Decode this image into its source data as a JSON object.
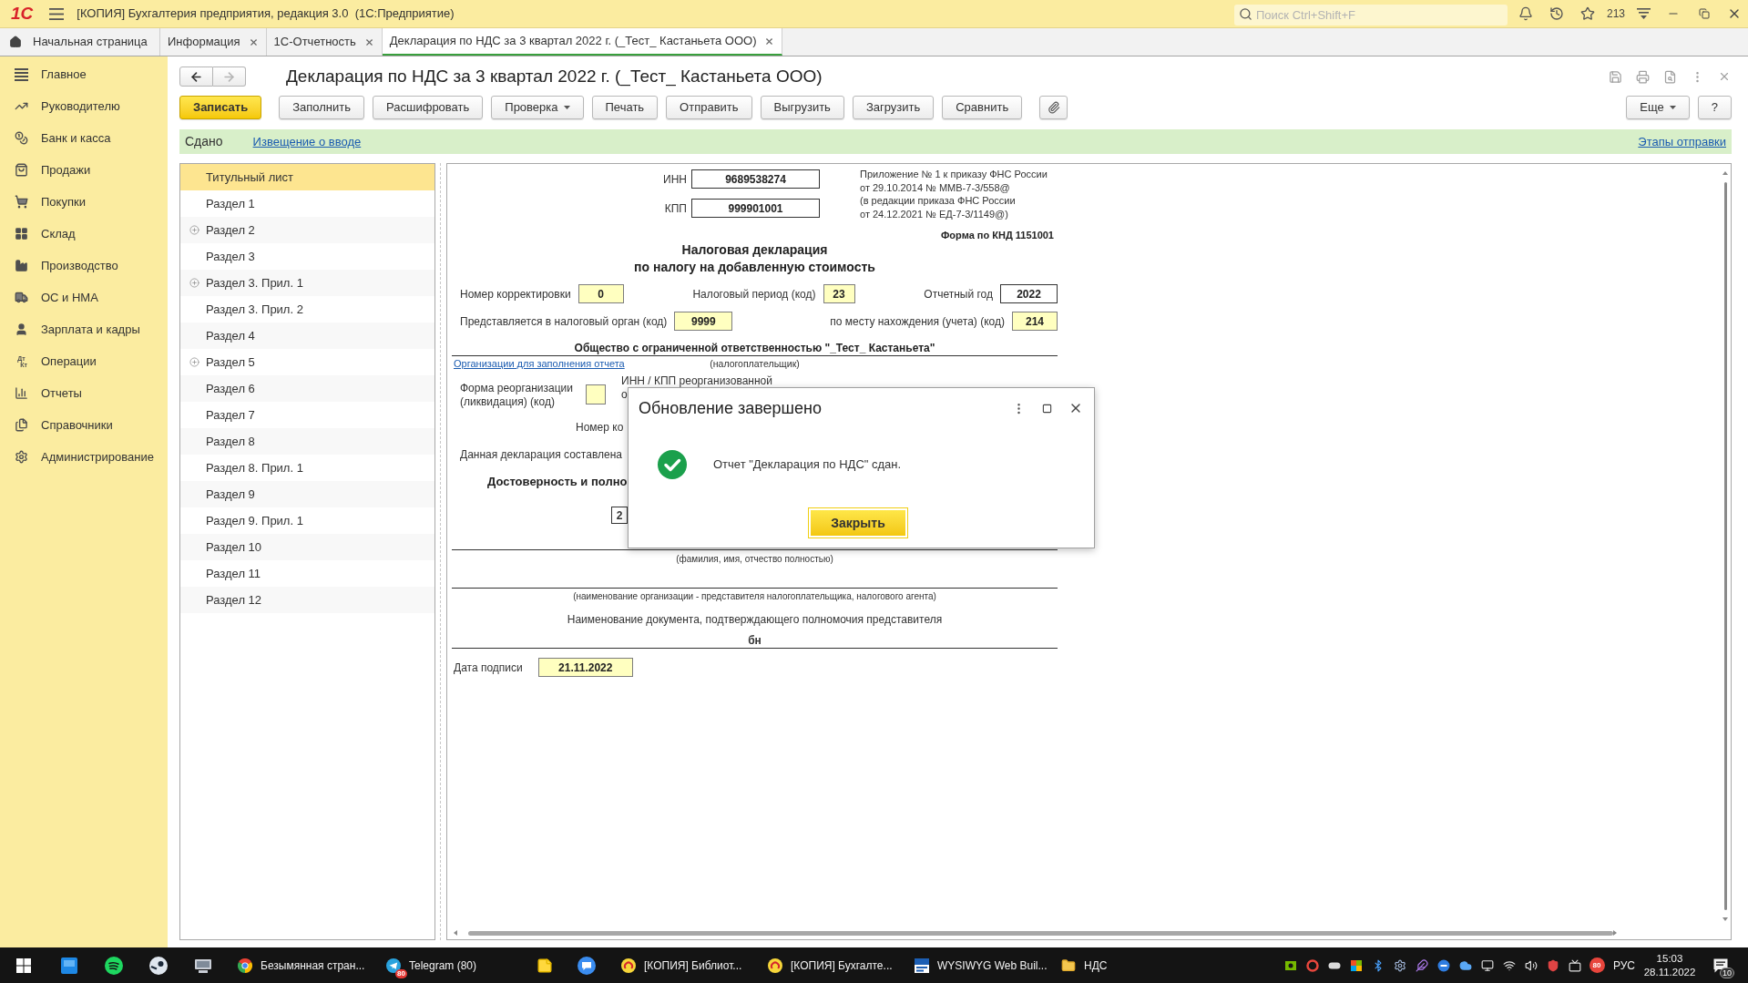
{
  "window": {
    "logo": "1С",
    "title": "[КОПИЯ] Бухгалтерия предприятия, редакция 3.0  (1С:Предприятие)",
    "search": {
      "placeholder": "Поиск Ctrl+Shift+F"
    },
    "counter": "213"
  },
  "tabs": [
    {
      "label": "Начальная страница",
      "kind": "home",
      "selected": false
    },
    {
      "label": "Информация",
      "kind": "page",
      "selected": false
    },
    {
      "label": "1С-Отчетность",
      "kind": "page",
      "selected": false
    },
    {
      "label": "Декларация по НДС за 3 квартал 2022 г. (_Тест_ Кастаньета ООО)",
      "kind": "page",
      "selected": true
    }
  ],
  "sidebar": {
    "items": [
      {
        "label": "Главное"
      },
      {
        "label": "Руководителю"
      },
      {
        "label": "Банк и касса"
      },
      {
        "label": "Продажи"
      },
      {
        "label": "Покупки"
      },
      {
        "label": "Склад"
      },
      {
        "label": "Производство"
      },
      {
        "label": "ОС и НМА"
      },
      {
        "label": "Зарплата и кадры"
      },
      {
        "label": "Операции",
        "icon_text": [
          "Дт",
          "Кт"
        ]
      },
      {
        "label": "Отчеты"
      },
      {
        "label": "Справочники"
      },
      {
        "label": "Администрирование"
      }
    ]
  },
  "document": {
    "navigation": {
      "back": {
        "disabled": false
      },
      "forward": {
        "disabled": true
      }
    },
    "title": "Декларация по НДС за 3 квартал 2022 г. (_Тест_ Кастаньета ООО)",
    "toolbar": [
      {
        "label": "Записать",
        "kind": "primary"
      },
      {
        "label": "Заполнить",
        "kind": "plain"
      },
      {
        "label": "Расшифровать",
        "kind": "plain"
      },
      {
        "label": "Проверка",
        "kind": "menu"
      },
      {
        "label": "Печать",
        "kind": "plain"
      },
      {
        "label": "Отправить",
        "kind": "plain"
      },
      {
        "label": "Выгрузить",
        "kind": "plain"
      },
      {
        "label": "Загрузить",
        "kind": "plain"
      },
      {
        "label": "Сравнить",
        "kind": "plain"
      }
    ],
    "toolbar_right": [
      {
        "label": "Еще",
        "kind": "menu"
      },
      {
        "label": "?",
        "kind": "plain"
      }
    ],
    "status": {
      "state": "Сдано",
      "link": "Извещение о вводе",
      "stages_link": "Этапы отправки"
    }
  },
  "sections": [
    {
      "label": "Титульный лист",
      "selected": true,
      "collapsed": false
    },
    {
      "label": "Раздел 1",
      "selected": false,
      "collapsed": false
    },
    {
      "label": "Раздел 2",
      "selected": false,
      "collapsed": true
    },
    {
      "label": "Раздел 3",
      "selected": false,
      "collapsed": false
    },
    {
      "label": "Раздел 3. Прил. 1",
      "selected": false,
      "collapsed": true
    },
    {
      "label": "Раздел 3. Прил. 2",
      "selected": false,
      "collapsed": false
    },
    {
      "label": "Раздел 4",
      "selected": false,
      "collapsed": false
    },
    {
      "label": "Раздел 5",
      "selected": false,
      "collapsed": true
    },
    {
      "label": "Раздел 6",
      "selected": false,
      "collapsed": false
    },
    {
      "label": "Раздел 7",
      "selected": false,
      "collapsed": false
    },
    {
      "label": "Раздел 8",
      "selected": false,
      "collapsed": false
    },
    {
      "label": "Раздел 8. Прил. 1",
      "selected": false,
      "collapsed": false
    },
    {
      "label": "Раздел 9",
      "selected": false,
      "collapsed": false
    },
    {
      "label": "Раздел 9. Прил. 1",
      "selected": false,
      "collapsed": false
    },
    {
      "label": "Раздел 10",
      "selected": false,
      "collapsed": false
    },
    {
      "label": "Раздел 11",
      "selected": false,
      "collapsed": false
    },
    {
      "label": "Раздел 12",
      "selected": false,
      "collapsed": false
    }
  ],
  "form": {
    "tax_ids": [
      {
        "label": "ИНН",
        "value": "9689538274",
        "editable": false
      },
      {
        "label": "КПП",
        "value": "999901001",
        "editable": false
      }
    ],
    "approval_note": "Приложение № 1 к приказу ФНС России\nот 29.10.2014 № ММВ-7-3/558@\n(в редакции приказа ФНС России\nот 24.12.2021 № ЕД-7-3/1149@)",
    "form_code": "Форма по КНД 1151001",
    "heading": "Налоговая декларация\nпо налогу на добавленную стоимость",
    "row_1": [
      {
        "label": "Номер корректировки",
        "value": "0",
        "editable": true
      },
      {
        "label": "Налоговый период (код)",
        "value": "23",
        "editable": true
      },
      {
        "label": "Отчетный год",
        "value": "2022",
        "editable": false
      }
    ],
    "row_2": [
      {
        "label": "Представляется в налоговый орган (код)",
        "value": "9999",
        "editable": true
      },
      {
        "label": "по месту нахождения (учета) (код)",
        "value": "214",
        "editable": true
      }
    ],
    "taxpayer": {
      "name": "Общество с ограниченной ответственностью \"_Тест_ Кастаньета\"",
      "link": "Организации для заполнения отчета",
      "caption": "(налогоплательщик)"
    },
    "reorganization": {
      "label": "Форма реорганизации (ликвидация) (код)",
      "editable": true,
      "inn_kpp_label": [
        "ИНН / КПП реорганизованной",
        "о"
      ]
    },
    "correction_label": "Номер ко",
    "composed_label": "Данная декларация составлена",
    "confirmation_heading": "Достоверность и полно",
    "signer": {
      "value": "2",
      "editable": false,
      "caption": "(фамилия, имя, отчество полностью)"
    },
    "representative_caption": "(наименование организации - представителя налогоплательщика, налогового агента)",
    "document_heading": "Наименование документа, подтверждающего полномочия представителя",
    "document_value": "бн",
    "signature_date": {
      "label": "Дата подписи",
      "value": "21.11.2022",
      "editable": true
    }
  },
  "dialog": {
    "title": "Обновление завершено",
    "message": "Отчет \"Декларация по НДС\" сдан.",
    "button": "Закрыть"
  },
  "taskbar": {
    "windows": [
      {
        "label": "Безымянная стран..."
      },
      {
        "label": "Telegram (80)",
        "badge": "80"
      },
      {
        "label": "[КОПИЯ] Библиот..."
      },
      {
        "label": "[КОПИЯ] Бухгалте..."
      },
      {
        "label": "WYSIWYG Web Buil..."
      },
      {
        "label": "НДС"
      }
    ],
    "tray_badge": "80",
    "language": "РУС",
    "time": "15:03",
    "date": "28.11.2022",
    "notifications": "10"
  }
}
